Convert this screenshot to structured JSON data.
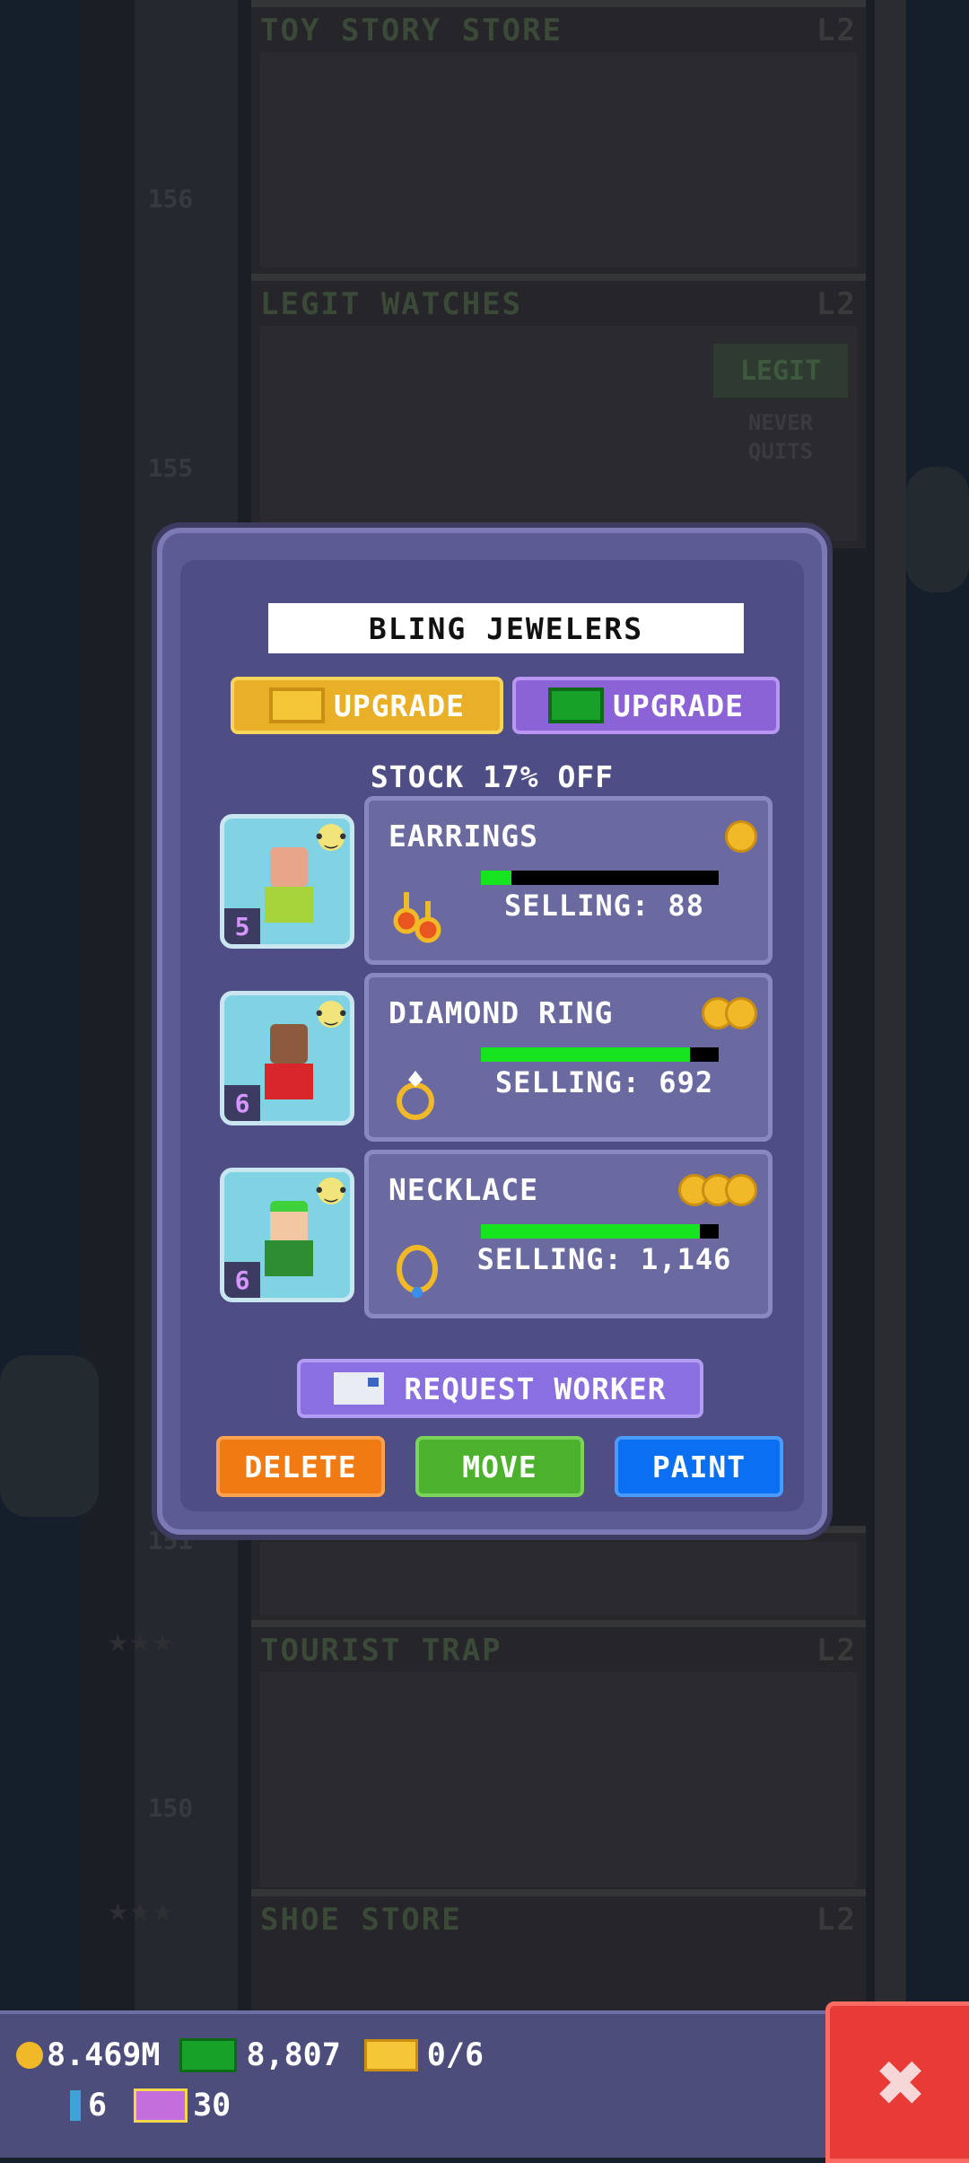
{
  "background": {
    "floors": [
      {
        "name": "TOY STORY STORE",
        "level": "L2",
        "number": "156"
      },
      {
        "name": "LEGIT WATCHES",
        "level": "L2",
        "number": "155"
      },
      {
        "name": "TOURIST TRAP",
        "level": "L2",
        "number": "150"
      },
      {
        "name": "SHOE STORE",
        "level": "L2",
        "number": ""
      }
    ],
    "floor_151_number": "151",
    "legit_sign": "LEGIT",
    "legit_slogan": "NEVER QUITS"
  },
  "modal": {
    "title": "BLING JEWELERS",
    "upgrade_coins_label": "UPGRADE",
    "upgrade_bux_label": "UPGRADE",
    "stock_discount": "STOCK 17% OFF",
    "slots": [
      {
        "worker_level": "5",
        "item_name": "EARRINGS",
        "selling": "SELLING: 88",
        "stock_fraction": 0.13,
        "coin_count": 1
      },
      {
        "worker_level": "6",
        "item_name": "DIAMOND RING",
        "selling": "SELLING: 692",
        "stock_fraction": 0.88,
        "coin_count": 2
      },
      {
        "worker_level": "6",
        "item_name": "NECKLACE",
        "selling": "SELLING: 1,146",
        "stock_fraction": 0.92,
        "coin_count": 3
      }
    ],
    "request_worker_label": "REQUEST WORKER",
    "delete_label": "DELETE",
    "move_label": "MOVE",
    "paint_label": "PAINT"
  },
  "hud": {
    "coins": "8.469M",
    "bux": "8,807",
    "gold_tickets": "0/6",
    "keys": "6",
    "vip": "30"
  },
  "colors": {
    "accent_green": "#16e41f",
    "upgrade_gold": "#e9b027",
    "upgrade_purple": "#8c63d6",
    "delete": "#f27a12",
    "move": "#4cb22e",
    "paint": "#0a6ff0",
    "close": "#e83a36"
  }
}
